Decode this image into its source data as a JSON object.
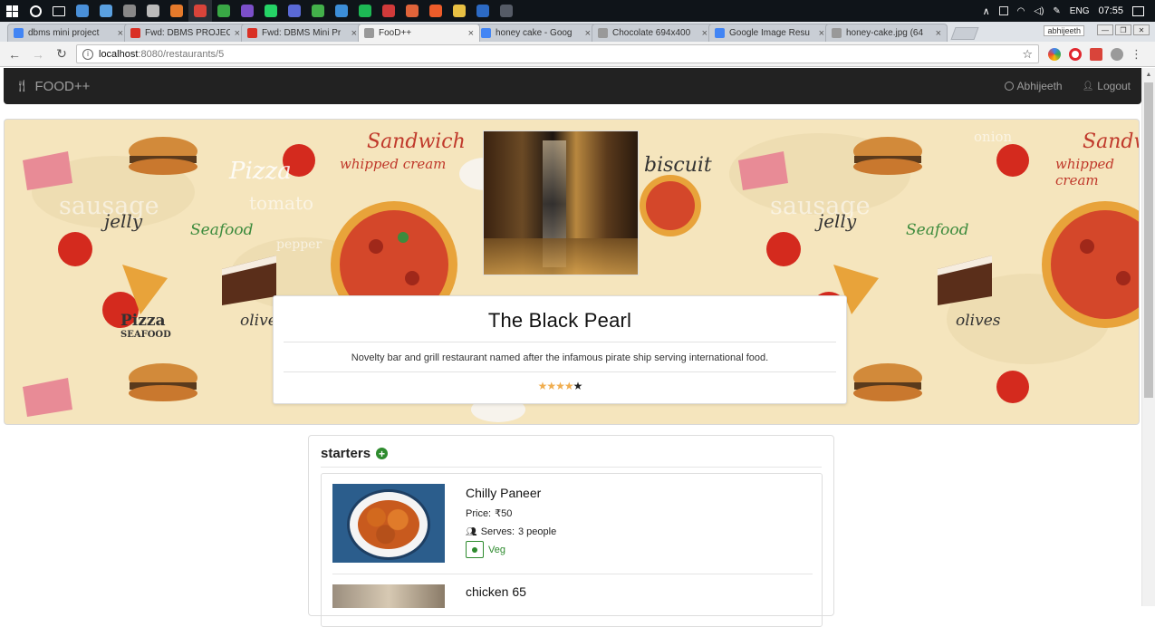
{
  "taskbar": {
    "icons": [
      {
        "name": "chrome-icon",
        "color": "#4a90d9"
      },
      {
        "name": "app-icon",
        "color": "#5aa0e0"
      },
      {
        "name": "app-icon",
        "color": "#888888"
      },
      {
        "name": "app-icon",
        "color": "#bbbbbb"
      },
      {
        "name": "app-icon",
        "color": "#e57a2b"
      },
      {
        "name": "chrome-icon",
        "color": "#d9443a"
      },
      {
        "name": "app-icon",
        "color": "#39a845"
      },
      {
        "name": "app-icon",
        "color": "#7b4fc9"
      },
      {
        "name": "whatsapp-icon",
        "color": "#25d366"
      },
      {
        "name": "app-icon",
        "color": "#5a6ad6"
      },
      {
        "name": "app-icon",
        "color": "#43b04a"
      },
      {
        "name": "app-icon",
        "color": "#3c8ed8"
      },
      {
        "name": "spotify-icon",
        "color": "#1db954"
      },
      {
        "name": "app-icon",
        "color": "#d13a3a"
      },
      {
        "name": "app-icon",
        "color": "#e0643a"
      },
      {
        "name": "app-icon",
        "color": "#ee5c2a"
      },
      {
        "name": "folder-icon",
        "color": "#e8c043"
      },
      {
        "name": "app-icon",
        "color": "#2c6ac4"
      },
      {
        "name": "app-icon",
        "color": "#555b66"
      }
    ],
    "language": "ENG",
    "time": "07:55"
  },
  "browser": {
    "tabs": [
      {
        "title": "dbms mini project",
        "favicon": "docs",
        "color": "#4285f4",
        "active": false
      },
      {
        "title": "Fwd: DBMS PROJEC",
        "favicon": "gmail",
        "color": "#d93025",
        "active": false
      },
      {
        "title": "Fwd: DBMS Mini Pr",
        "favicon": "gmail",
        "color": "#d93025",
        "active": false
      },
      {
        "title": "FooD++",
        "favicon": "page",
        "color": "#999999",
        "active": true
      },
      {
        "title": "honey cake - Goog",
        "favicon": "google",
        "color": "#4285f4",
        "active": false
      },
      {
        "title": "Chocolate 694x400",
        "favicon": "page",
        "color": "#999999",
        "active": false
      },
      {
        "title": "Google Image Resu",
        "favicon": "google",
        "color": "#4285f4",
        "active": false
      },
      {
        "title": "honey-cake.jpg (64",
        "favicon": "page",
        "color": "#999999",
        "active": false
      }
    ],
    "profile": "abhijeeth",
    "url_host": "localhost",
    "url_path": ":8080/restaurants/5"
  },
  "navbar": {
    "brand": "FOOD++",
    "user": "Abhijeeth",
    "logout": "Logout"
  },
  "restaurant": {
    "name": "The Black Pearl",
    "description": "Novelty bar and grill restaurant named after the infamous pirate ship serving international food.",
    "rating": 4,
    "rating_max": 5
  },
  "hero_words": [
    {
      "text": "Sandwich",
      "style": "red"
    },
    {
      "text": "whipped cream",
      "style": "red"
    },
    {
      "text": "Pizza",
      "style": "white"
    },
    {
      "text": "sausage",
      "style": "white"
    },
    {
      "text": "tomato",
      "style": "white"
    },
    {
      "text": "Seafood",
      "style": "green"
    },
    {
      "text": "jelly",
      "style": "dark"
    },
    {
      "text": "olives",
      "style": "dark"
    },
    {
      "text": "biscuit",
      "style": "dark"
    },
    {
      "text": "onion",
      "style": "white"
    },
    {
      "text": "pepper",
      "style": "white"
    },
    {
      "text": "Pizza",
      "style": "dark"
    },
    {
      "text": "SEAFOOD",
      "style": "dark"
    }
  ],
  "menu": {
    "category": "starters",
    "items": [
      {
        "name": "Chilly Paneer",
        "price_label": "Price:",
        "price": "₹50",
        "serves_label": "Serves:",
        "serves": "3 people",
        "type": "Veg"
      },
      {
        "name": "chicken 65"
      }
    ]
  }
}
